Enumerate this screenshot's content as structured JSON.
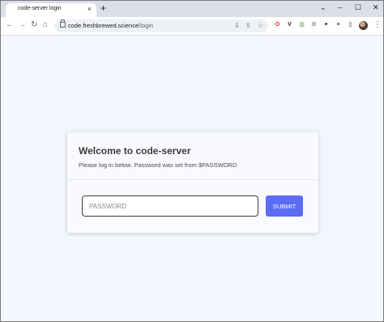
{
  "tab": {
    "title": "code-server login",
    "close": "×",
    "new_tab": "+"
  },
  "window_controls": {
    "dropdown": "⌄",
    "minimize": "–",
    "maximize": "☐",
    "close": "✕"
  },
  "toolbar": {
    "back": "←",
    "forward": "→",
    "reload": "↻",
    "home": "⌂",
    "url_host": "code.freshbrewed.science",
    "url_path": "/login",
    "omni_icons": [
      "⇩",
      "⇪",
      "☆"
    ],
    "extensions": [
      {
        "name": "opera-icon",
        "glyph": "O",
        "color": "#e0292d"
      },
      {
        "name": "vivaldi-icon",
        "glyph": "V",
        "color": "#202124"
      },
      {
        "name": "docs-icon",
        "glyph": "▥",
        "color": "#5f9d3f"
      },
      {
        "name": "chrome-ext-icon",
        "glyph": "⚙",
        "color": "#5f6368"
      },
      {
        "name": "puzzle-icon",
        "glyph": "✦",
        "color": "#202124"
      },
      {
        "name": "media-icon",
        "glyph": "≡",
        "color": "#202124"
      },
      {
        "name": "sidepanel-icon",
        "glyph": "▯",
        "color": "#202124"
      }
    ],
    "menu": "⋮"
  },
  "login": {
    "title": "Welcome to code-server",
    "subtitle": "Please log in below. Password was set from $PASSWORD.",
    "password_placeholder": "PASSWORD",
    "submit_label": "SUBMIT"
  },
  "colors": {
    "accent": "#5b6cf5",
    "page_bg": "#f3f6fc",
    "card_bg": "#f8fafd"
  }
}
